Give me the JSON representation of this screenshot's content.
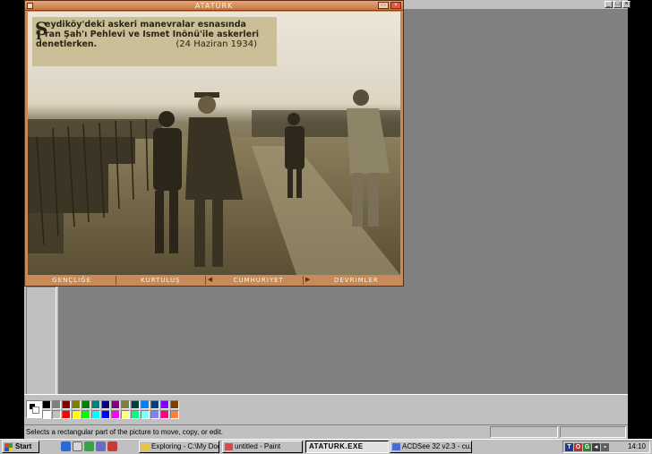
{
  "atatürk_window": {
    "title": "ATATÜRK",
    "caption": {
      "drop_cap": "S",
      "line1": "eydiköy'deki askeri manevralar esnasında",
      "line2_cap": "I",
      "line2": "ran Şah'ı Pehlevi ve Ismet Inönü'ile askerleri",
      "line3": "denetlerken.",
      "date": "(24 Haziran 1934)"
    },
    "nav": [
      "GENÇLIĞE",
      "KURTULUŞ",
      "CUMHURIYET",
      "DEVRIMLER"
    ]
  },
  "paint": {
    "status_text": "Selects a rectangular part of the picture to move, copy, or edit.",
    "palette_colors": [
      "#000000",
      "#808080",
      "#800000",
      "#808000",
      "#008000",
      "#008080",
      "#000080",
      "#800080",
      "#808040",
      "#004040",
      "#0080ff",
      "#004080",
      "#8000ff",
      "#804000",
      "#ffffff",
      "#c0c0c0",
      "#ff0000",
      "#ffff00",
      "#00ff00",
      "#00ffff",
      "#0000ff",
      "#ff00ff",
      "#ffff80",
      "#00ff80",
      "#80ffff",
      "#8080ff",
      "#ff0080",
      "#ff8040"
    ]
  },
  "taskbar": {
    "start_label": "Start",
    "buttons": [
      {
        "label": "Exploring - C:\\My Doc..."
      },
      {
        "label": "untitled - Paint"
      },
      {
        "label": "ATATURK.EXE"
      },
      {
        "label": "ACDSee 32 v2.3 - cu..."
      }
    ],
    "clock": "14:10"
  },
  "colors": {
    "window_accent": "#c98a5a",
    "desktop_gray": "#808080"
  }
}
